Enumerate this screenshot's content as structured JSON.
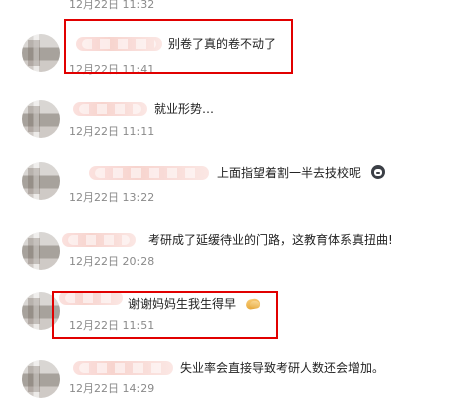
{
  "comments": [
    {
      "id": "top-cut",
      "text": "",
      "time": "12月22日 11:32"
    },
    {
      "id": "c1",
      "text": "别卷了真的卷不动了",
      "time": "12月22日 11:41",
      "highlighted": true
    },
    {
      "id": "c2",
      "text": "就业形势…",
      "time": "12月22日 11:11"
    },
    {
      "id": "c3",
      "text": "上面指望着割一半去技校呢",
      "time": "12月22日 13:22",
      "emoji": "face-icon"
    },
    {
      "id": "c4",
      "text": "考研成了延缓待业的门路，这教育体系真扭曲!",
      "time": "12月22日 20:28"
    },
    {
      "id": "c5",
      "text": "谢谢妈妈生我生得早",
      "time": "12月22日 11:51",
      "highlighted": true,
      "emoji": "clap-icon"
    },
    {
      "id": "c6",
      "text": "失业率会直接导致考研人数还会增加。",
      "time": "12月22日 14:29"
    }
  ],
  "colors": {
    "highlight": "#e10000",
    "time": "#8a8a8a",
    "text": "#222222"
  }
}
